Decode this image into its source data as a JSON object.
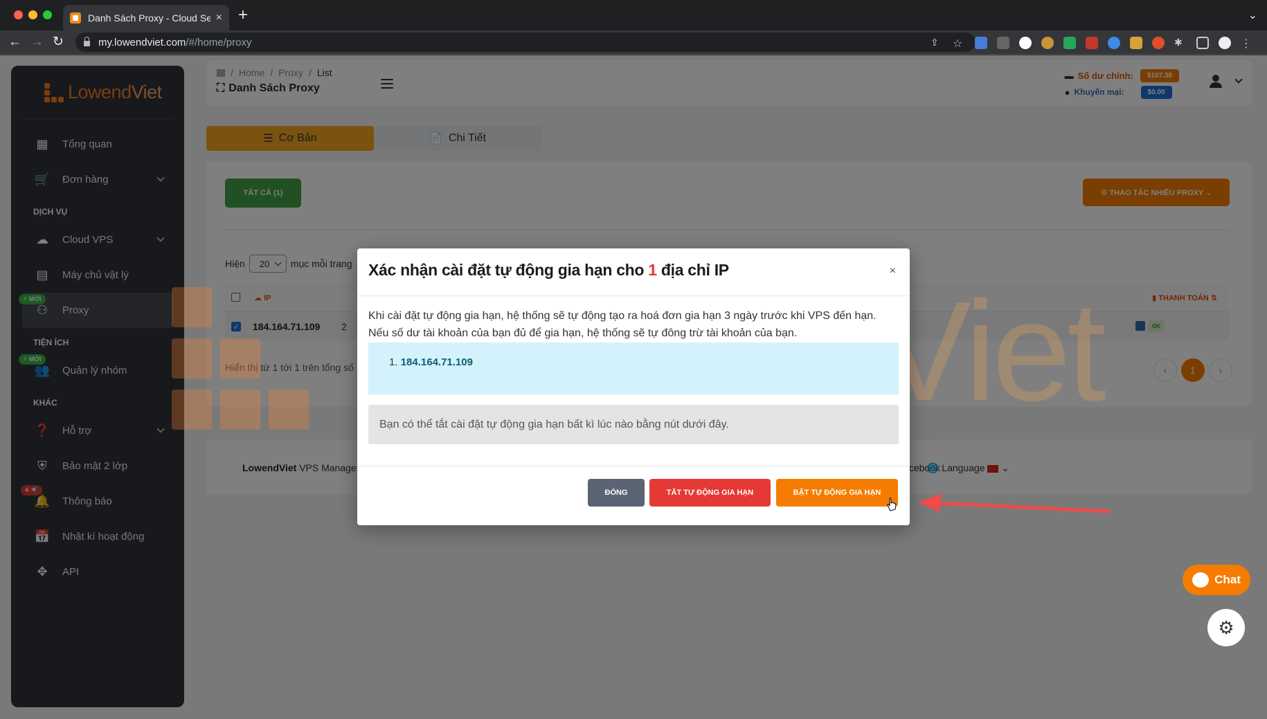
{
  "browser": {
    "tab_title": "Danh Sách Proxy - Cloud Servi",
    "tab_close": "×",
    "new_tab": "+",
    "url_host": "my.lowendviet.com",
    "url_path": "/#/home/proxy"
  },
  "brand": {
    "name_a": "Lowend",
    "name_b": "Viet"
  },
  "sidebar": {
    "items_top": [
      {
        "label": "Tổng quan",
        "icon": "dashboard-icon"
      },
      {
        "label": "Đơn hàng",
        "icon": "cart-icon"
      }
    ],
    "section_services": "DỊCH VỤ",
    "items_services": [
      {
        "label": "Cloud VPS",
        "icon": "cloud-icon"
      },
      {
        "label": "Máy chủ vật lý",
        "icon": "server-icon"
      },
      {
        "label": "Proxy",
        "icon": "proxy-icon",
        "badge": "⚡ MỚI"
      }
    ],
    "section_utils": "TIỆN ÍCH",
    "items_utils": [
      {
        "label": "Quản lý nhóm",
        "icon": "group-icon",
        "badge": "⚡ MỚI"
      }
    ],
    "section_other": "KHÁC",
    "items_other": [
      {
        "label": "Hỗ trợ",
        "icon": "help-icon"
      },
      {
        "label": "Bảo mật 2 lớp",
        "icon": "shield-icon"
      },
      {
        "label": "Thông báo",
        "icon": "bell-icon",
        "badge": "4 📢"
      },
      {
        "label": "Nhật kí hoạt động",
        "icon": "calendar-icon"
      },
      {
        "label": "API",
        "icon": "api-icon"
      }
    ]
  },
  "topbar": {
    "breadcrumb": [
      "Home",
      "Proxy",
      "List"
    ],
    "breadcrumb_sep": "/",
    "page_title": "Danh Sách Proxy",
    "balance_main_label": "Số dư chính:",
    "balance_main_value": "$107.38",
    "balance_promo_label": "Khuyến mại:",
    "balance_promo_value": "$0.00"
  },
  "tabs": {
    "basic": "Cơ Bản",
    "detail": "Chi Tiết"
  },
  "card": {
    "all_button": "TẤT CẢ (1)",
    "bulk_button": "⚙ THAO TÁC NHIỀU PROXY ⌄",
    "show_label": "Hiện",
    "per_page": "20",
    "per_page_suffix": "mục mỗi trang",
    "col_ip": "IP",
    "col_pay": "THANH TOÁN",
    "row_ip": "184.164.71.109",
    "row_num": "2",
    "row_status": "OK",
    "info": "Hiển thị từ 1 tới 1 trên tổng số",
    "page_prev": "‹",
    "page_current": "1",
    "page_next": "›"
  },
  "footer": {
    "brand": "LowendViet",
    "suffix": " VPS Manager",
    "facebook": "Facebook",
    "language": "Language"
  },
  "modal": {
    "title_a": "Xác nhận cài đặt tự động gia hạn cho ",
    "title_count": "1",
    "title_b": " địa chỉ IP",
    "close": "×",
    "description": "Khi cài đặt tự động gia hạn, hệ thống sẽ tự động tạo ra hoá đơn gia hạn 3 ngày trước khi VPS đến hạn. Nếu số dư tài khoản của bạn đủ để gia hạn, hệ thống sẽ tự đông trừ tài khoản của bạn.",
    "ip_index": "1.",
    "ip_value": "184.164.71.109",
    "note": "Bạn có thể tắt cài đặt tự động gia hạn bất kì lúc nào bằng nút dưới đây.",
    "btn_close": "ĐÓNG",
    "btn_disable": "TẮT TỰ ĐỘNG GIA HẠN",
    "btn_enable": "BẬT TỰ ĐỘNG GIA HẠN"
  },
  "watermark": {
    "a": "Lowend",
    "b": "Viet"
  },
  "chat": {
    "label": "Chat"
  },
  "colors": {
    "accent": "#f57c00",
    "danger": "#e53935",
    "success": "#43a047",
    "sidebar_bg": "#2f3339",
    "annotation_arrow": "#ee4b4b"
  }
}
